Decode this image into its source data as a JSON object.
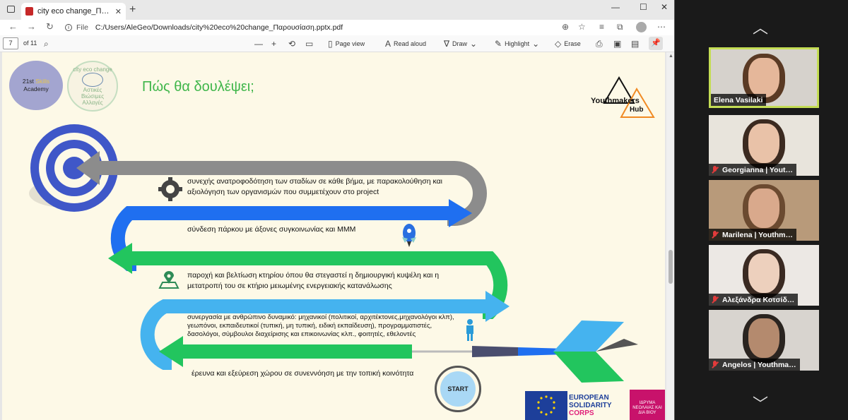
{
  "browser": {
    "tab_title": "city eco change_Παρουσίαση.pp",
    "tab_close": "✕",
    "new_tab": "+",
    "window_controls": {
      "minimize": "—",
      "maximize": "☐",
      "close": "✕"
    },
    "address": {
      "file_label": "File",
      "path": "C:/Users/AleGeo/Downloads/city%20eco%20change_Παρουσίαση.pptx.pdf"
    }
  },
  "pdf_toolbar": {
    "page_number": "7",
    "page_count": "of 11",
    "page_view": "Page view",
    "read_aloud": "Read aloud",
    "draw": "Draw",
    "highlight": "Highlight",
    "erase": "Erase"
  },
  "slide": {
    "title": "Πώς θα δουλέψει;",
    "logo_left": {
      "line1": "21st",
      "line1b": "Skills",
      "line2": "Academy"
    },
    "logo_mid": {
      "top": "city eco change",
      "bottom": "Αστικές Βιώσιμες Αλλαγές"
    },
    "logo_right": {
      "name": "Youthmakers",
      "sub": "Hub"
    },
    "steps": [
      "συνεχής ανατροφοδότηση των σταδίων σε κάθε βήμα, με παρακολούθηση και αξιολόγηση των οργανισμών που συμμετέχουν στο project",
      "σύνδεση πάρκου με άξονες συγκοινωνίας και ΜΜΜ",
      "παροχή και βελτίωση κτηρίου όπου θα στεγαστεί η δημιουργική κυψέλη και η μετατροπή του σε κτήριο μειωμένης ενεργειακής κατανάλωσης",
      "συνεργασία με ανθρώπινο δυναμικό: μηχανικοί (πολιτικοί, αρχιτέκτονες,μηχανολόγοι κλπ), γεωπόνοι, εκπαιδευτικοί (τυπική, μη τυπική, ειδική εκπαίδευση), προγραμματιστές, δασολόγοι, σύμβουλοι διαχείρισης και επικοινωνίας κλπ., φοιτητές, εθελοντές",
      "έρευνα και εξεύρεση χώρου σε συνεννόηση με την τοπική κοινότητα"
    ],
    "start_label": "START",
    "footer": {
      "esc_line1": "EUROPEAN",
      "esc_line2": "SOLIDARITY",
      "esc_line3": "CORPS",
      "inedivim": "ΙΔΡΥΜΑ ΝΕΟΛΑΙΑΣ ΚΑΙ ΔΙΑ ΒΙΟΥ"
    }
  },
  "participants": [
    {
      "name": "Elena Vasilaki",
      "muted": false,
      "active": true
    },
    {
      "name": "Georgianna | Yout…",
      "muted": true,
      "active": false
    },
    {
      "name": "Marilena | Youthm…",
      "muted": true,
      "active": false
    },
    {
      "name": "Αλεξάνδρα Κοτσίδ…",
      "muted": true,
      "active": false
    },
    {
      "name": "Angelos | Youthma…",
      "muted": true,
      "active": false
    }
  ]
}
